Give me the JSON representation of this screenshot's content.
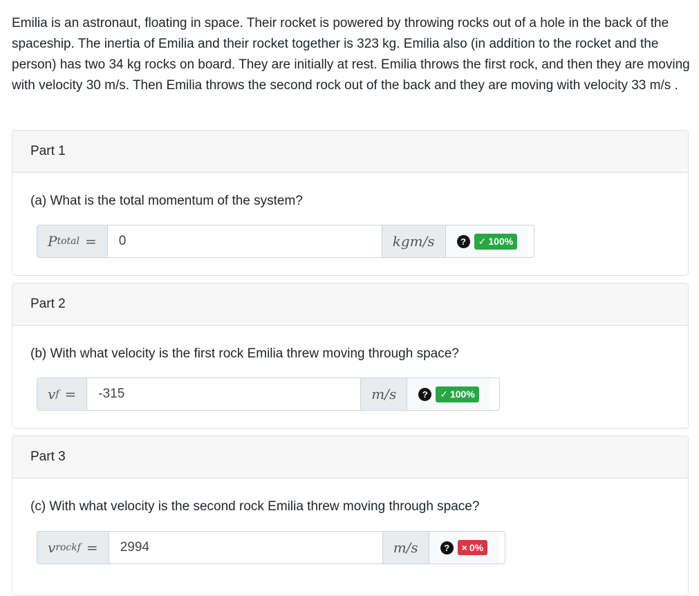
{
  "question": "Emilia is an astronaut, floating in space. Their rocket is powered by throwing rocks out of a hole in the back of the spaceship. The inertia of Emilia and their rocket together is 323 kg. Emilia also (in addition to the rocket and the person) has two 34 kg rocks on board. They are initially at rest. Emilia throws the first rock, and then they are moving with velocity 30 m/s. Then Emilia throws the second rock out of the back and they are moving with velocity 33 m/s .",
  "parts": [
    {
      "header": "Part 1",
      "prompt": "(a) What is the total momentum of the system?",
      "var": "P",
      "sub": "total",
      "eq": "=",
      "value": "0",
      "unit": "kgm/s",
      "help": "?",
      "badge_icon": "✓",
      "badge_text": "100%",
      "badge_status": "correct"
    },
    {
      "header": "Part 2",
      "prompt": "(b) With what velocity is the first rock Emilia threw moving through space?",
      "var": "v",
      "sub": "f",
      "eq": "=",
      "value": "-315",
      "unit": "m/s",
      "help": "?",
      "badge_icon": "✓",
      "badge_text": "100%",
      "badge_status": "correct"
    },
    {
      "header": "Part 3",
      "prompt": "(c) With what velocity is the second rock Emilia threw moving through space?",
      "var": "v",
      "sub": "rockf",
      "eq": "=",
      "value": "2994",
      "unit": "m/s",
      "help": "?",
      "badge_icon": "×",
      "badge_text": "0%",
      "badge_status": "incorrect"
    }
  ],
  "colors": {
    "correct": "#28a745",
    "incorrect": "#dc3545"
  }
}
